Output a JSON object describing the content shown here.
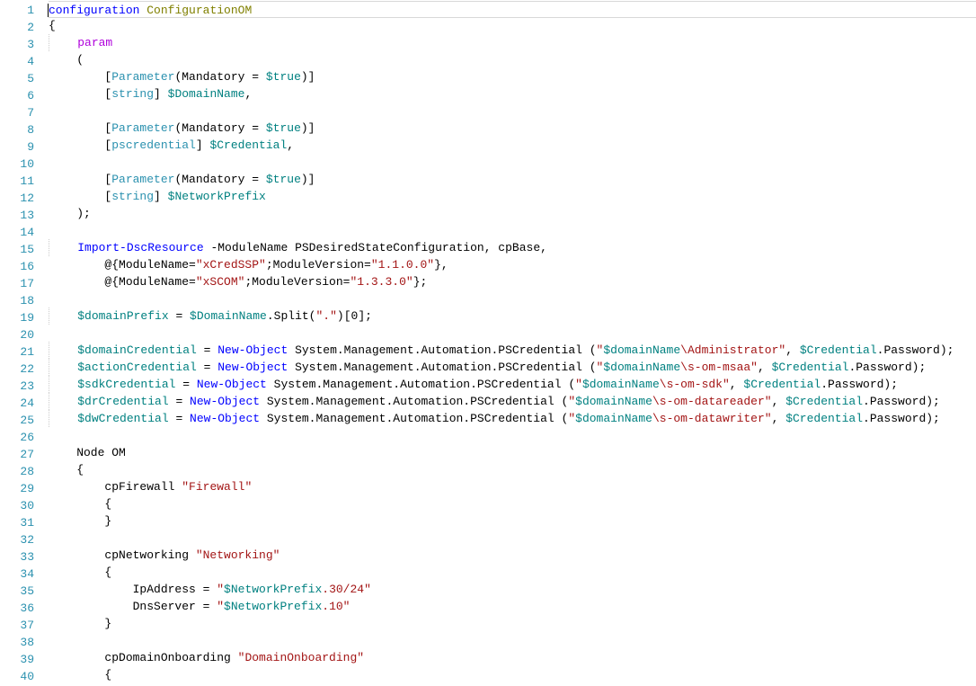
{
  "lines": {
    "count": 40,
    "1": [
      [
        "kw-blue",
        "configuration"
      ],
      [
        "",
        ""
      ],
      [
        "",
        " "
      ],
      [
        "tok-olive",
        "ConfigurationOM"
      ]
    ],
    "2": [
      [
        "",
        "{"
      ]
    ],
    "3": [
      [
        "",
        "    "
      ],
      [
        "tok-magenta",
        "param"
      ]
    ],
    "4": [
      [
        "",
        "    ("
      ]
    ],
    "5": [
      [
        "",
        "        ["
      ],
      [
        "tok-type",
        "Parameter"
      ],
      [
        "",
        "(Mandatory = "
      ],
      [
        "tok-var",
        "$true"
      ],
      [
        "",
        ")]"
      ]
    ],
    "6": [
      [
        "",
        "        ["
      ],
      [
        "tok-type",
        "string"
      ],
      [
        "",
        "] "
      ],
      [
        "tok-var",
        "$DomainName"
      ],
      [
        "",
        ","
      ]
    ],
    "7": [
      [
        "",
        ""
      ]
    ],
    "8": [
      [
        "",
        "        ["
      ],
      [
        "tok-type",
        "Parameter"
      ],
      [
        "",
        "(Mandatory = "
      ],
      [
        "tok-var",
        "$true"
      ],
      [
        "",
        ")]"
      ]
    ],
    "9": [
      [
        "",
        "        ["
      ],
      [
        "tok-type",
        "pscredential"
      ],
      [
        "",
        "] "
      ],
      [
        "tok-var",
        "$Credential"
      ],
      [
        "",
        ","
      ]
    ],
    "10": [
      [
        "",
        ""
      ]
    ],
    "11": [
      [
        "",
        "        ["
      ],
      [
        "tok-type",
        "Parameter"
      ],
      [
        "",
        "(Mandatory = "
      ],
      [
        "tok-var",
        "$true"
      ],
      [
        "",
        ")]"
      ]
    ],
    "12": [
      [
        "",
        "        ["
      ],
      [
        "tok-type",
        "string"
      ],
      [
        "",
        "] "
      ],
      [
        "tok-var",
        "$NetworkPrefix"
      ]
    ],
    "13": [
      [
        "",
        "    );"
      ]
    ],
    "14": [
      [
        "",
        ""
      ]
    ],
    "15": [
      [
        "",
        "    "
      ],
      [
        "kw-blue",
        "Import-DscResource"
      ],
      [
        "",
        " -ModuleName PSDesiredStateConfiguration, cpBase,"
      ]
    ],
    "16": [
      [
        "",
        "        @{ModuleName="
      ],
      [
        "tok-str",
        "\"xCredSSP\""
      ],
      [
        "",
        ";ModuleVersion="
      ],
      [
        "tok-str",
        "\"1.1.0.0\""
      ],
      [
        "",
        "},"
      ]
    ],
    "17": [
      [
        "",
        "        @{ModuleName="
      ],
      [
        "tok-str",
        "\"xSCOM\""
      ],
      [
        "",
        ";ModuleVersion="
      ],
      [
        "tok-str",
        "\"1.3.3.0\""
      ],
      [
        "",
        "};"
      ]
    ],
    "18": [
      [
        "",
        ""
      ]
    ],
    "19": [
      [
        "",
        "    "
      ],
      [
        "tok-var",
        "$domainPrefix"
      ],
      [
        "",
        " = "
      ],
      [
        "tok-var",
        "$DomainName"
      ],
      [
        "",
        ".Split("
      ],
      [
        "tok-str",
        "\".\""
      ],
      [
        "",
        ")["
      ],
      [
        "",
        "0"
      ],
      [
        "",
        "];"
      ]
    ],
    "20": [
      [
        "",
        ""
      ]
    ],
    "21": [
      [
        "",
        "    "
      ],
      [
        "tok-var",
        "$domainCredential"
      ],
      [
        "",
        " = "
      ],
      [
        "kw-blue",
        "New-Object"
      ],
      [
        "",
        " System.Management.Automation.PSCredential ("
      ],
      [
        "tok-str",
        "\""
      ],
      [
        "tok-var",
        "$domainName"
      ],
      [
        "tok-str",
        "\\Administrator\""
      ],
      [
        "",
        ", "
      ],
      [
        "tok-var",
        "$Credential"
      ],
      [
        "",
        ".Password);"
      ]
    ],
    "22": [
      [
        "",
        "    "
      ],
      [
        "tok-var",
        "$actionCredential"
      ],
      [
        "",
        " = "
      ],
      [
        "kw-blue",
        "New-Object"
      ],
      [
        "",
        " System.Management.Automation.PSCredential ("
      ],
      [
        "tok-str",
        "\""
      ],
      [
        "tok-var",
        "$domainName"
      ],
      [
        "tok-str",
        "\\s-om-msaa\""
      ],
      [
        "",
        ", "
      ],
      [
        "tok-var",
        "$Credential"
      ],
      [
        "",
        ".Password);"
      ]
    ],
    "23": [
      [
        "",
        "    "
      ],
      [
        "tok-var",
        "$sdkCredential"
      ],
      [
        "",
        " = "
      ],
      [
        "kw-blue",
        "New-Object"
      ],
      [
        "",
        " System.Management.Automation.PSCredential ("
      ],
      [
        "tok-str",
        "\""
      ],
      [
        "tok-var",
        "$domainName"
      ],
      [
        "tok-str",
        "\\s-om-sdk\""
      ],
      [
        "",
        ", "
      ],
      [
        "tok-var",
        "$Credential"
      ],
      [
        "",
        ".Password);"
      ]
    ],
    "24": [
      [
        "",
        "    "
      ],
      [
        "tok-var",
        "$drCredential"
      ],
      [
        "",
        " = "
      ],
      [
        "kw-blue",
        "New-Object"
      ],
      [
        "",
        " System.Management.Automation.PSCredential ("
      ],
      [
        "tok-str",
        "\""
      ],
      [
        "tok-var",
        "$domainName"
      ],
      [
        "tok-str",
        "\\s-om-datareader\""
      ],
      [
        "",
        ", "
      ],
      [
        "tok-var",
        "$Credential"
      ],
      [
        "",
        ".Password);"
      ]
    ],
    "25": [
      [
        "",
        "    "
      ],
      [
        "tok-var",
        "$dwCredential"
      ],
      [
        "",
        " = "
      ],
      [
        "kw-blue",
        "New-Object"
      ],
      [
        "",
        " System.Management.Automation.PSCredential ("
      ],
      [
        "tok-str",
        "\""
      ],
      [
        "tok-var",
        "$domainName"
      ],
      [
        "tok-str",
        "\\s-om-datawriter\""
      ],
      [
        "",
        ", "
      ],
      [
        "tok-var",
        "$Credential"
      ],
      [
        "",
        ".Password);"
      ]
    ],
    "26": [
      [
        "",
        ""
      ]
    ],
    "27": [
      [
        "",
        "    Node OM"
      ]
    ],
    "28": [
      [
        "",
        "    {"
      ]
    ],
    "29": [
      [
        "",
        "        cpFirewall "
      ],
      [
        "tok-str",
        "\"Firewall\""
      ]
    ],
    "30": [
      [
        "",
        "        {"
      ]
    ],
    "31": [
      [
        "",
        "        }"
      ]
    ],
    "32": [
      [
        "",
        ""
      ]
    ],
    "33": [
      [
        "",
        "        cpNetworking "
      ],
      [
        "tok-str",
        "\"Networking\""
      ]
    ],
    "34": [
      [
        "",
        "        {"
      ]
    ],
    "35": [
      [
        "",
        "            IpAddress = "
      ],
      [
        "tok-str",
        "\""
      ],
      [
        "tok-var",
        "$NetworkPrefix"
      ],
      [
        "tok-str",
        ".30/24\""
      ]
    ],
    "36": [
      [
        "",
        "            DnsServer = "
      ],
      [
        "tok-str",
        "\""
      ],
      [
        "tok-var",
        "$NetworkPrefix"
      ],
      [
        "tok-str",
        ".10\""
      ]
    ],
    "37": [
      [
        "",
        "        }"
      ]
    ],
    "38": [
      [
        "",
        ""
      ]
    ],
    "39": [
      [
        "",
        "        cpDomainOnboarding "
      ],
      [
        "tok-str",
        "\"DomainOnboarding\""
      ]
    ],
    "40": [
      [
        "",
        "        {"
      ]
    ]
  }
}
